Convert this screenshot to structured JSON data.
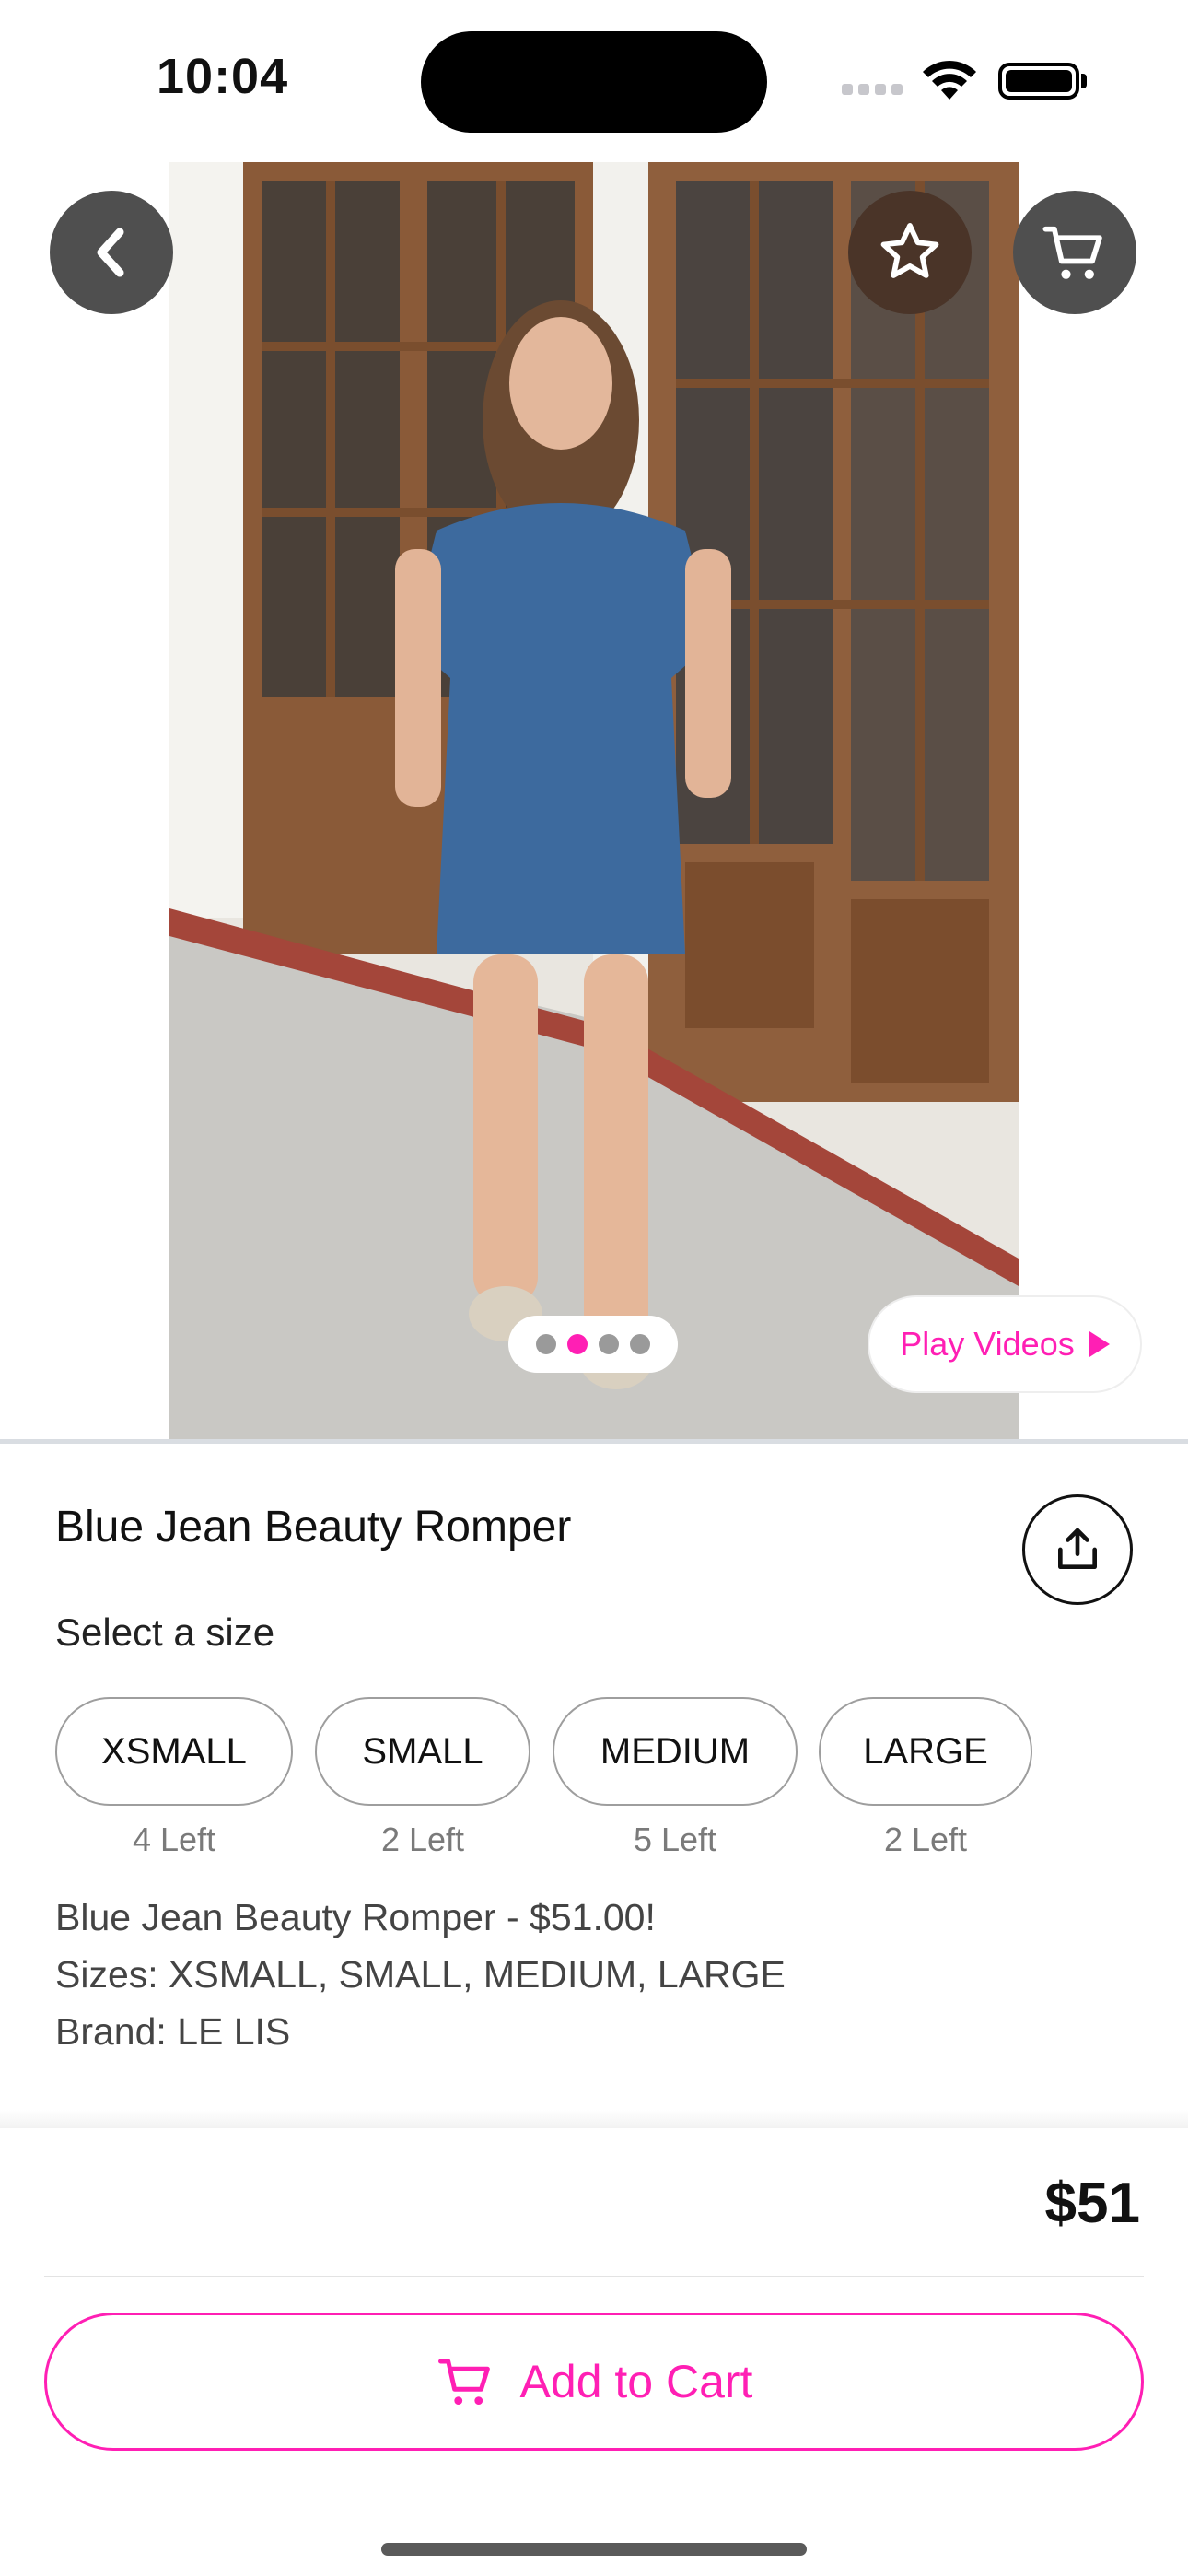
{
  "status_bar": {
    "time": "10:04"
  },
  "hero": {
    "image_alt": "Woman in denim romper standing in front of wooden doors",
    "pagination": {
      "count": 4,
      "active_index": 1
    },
    "play_videos_label": "Play Videos"
  },
  "product": {
    "title": "Blue Jean Beauty Romper",
    "select_size_label": "Select a size",
    "sizes": [
      {
        "label": "XSMALL",
        "stock": "4 Left"
      },
      {
        "label": "SMALL",
        "stock": "2 Left"
      },
      {
        "label": "MEDIUM",
        "stock": "5 Left"
      },
      {
        "label": "LARGE",
        "stock": "2 Left"
      }
    ],
    "description": [
      "Blue Jean Beauty Romper - $51.00!",
      "Sizes: XSMALL, SMALL, MEDIUM, LARGE",
      "Brand: LE LIS"
    ]
  },
  "checkout": {
    "price": "$51",
    "add_to_cart_label": "Add to Cart"
  },
  "colors": {
    "accent": "#ff1fb4",
    "dark_button": "#4f4f4f",
    "favorite_button": "#4a3428"
  },
  "icons": [
    "back-chevron-icon",
    "star-icon",
    "cart-icon",
    "share-icon",
    "play-icon",
    "cart-outline-icon"
  ]
}
